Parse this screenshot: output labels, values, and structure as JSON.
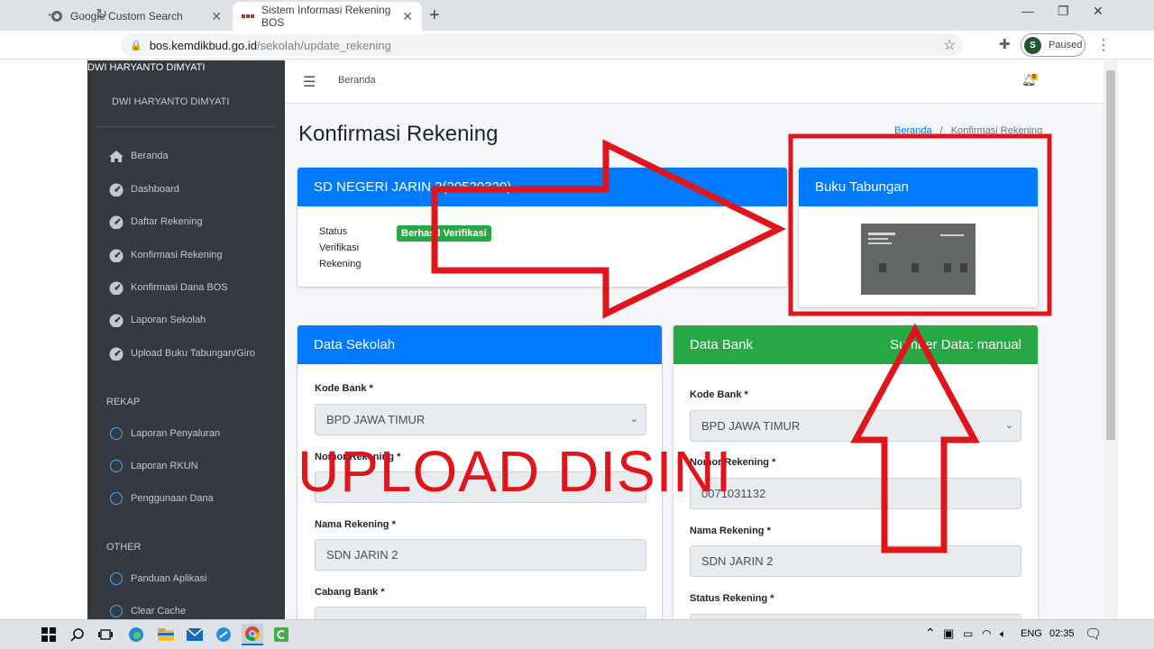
{
  "browser": {
    "tabs": [
      {
        "label": "Google Custom Search",
        "active": false
      },
      {
        "label": "Sistem Informasi Rekening BOS",
        "active": true
      }
    ],
    "url_host": "bos.kemdikbud.go.id",
    "url_path": "/sekolah/update_rekening",
    "profile_initial": "S",
    "profile_status": "Paused"
  },
  "sidebar": {
    "brand": "DWI HARYANTO DIMYATI",
    "user": "DWI HARYANTO DIMYATI",
    "items": [
      {
        "label": "Beranda",
        "icon": "home-icon"
      },
      {
        "label": "Dashboard",
        "icon": "dashboard-gauge-icon"
      },
      {
        "label": "Daftar Rekening",
        "icon": "dashboard-gauge-icon"
      },
      {
        "label": "Konfirmasi Rekening",
        "icon": "dashboard-gauge-icon"
      },
      {
        "label": "Konfirmasi Dana BOS",
        "icon": "dashboard-gauge-icon"
      },
      {
        "label": "Laporan Sekolah",
        "icon": "dashboard-gauge-icon"
      },
      {
        "label": "Upload Buku Tabungan/Giro",
        "icon": "dashboard-gauge-icon"
      }
    ],
    "rekap_header": "REKAP",
    "rekap_items": [
      "Laporan Penyaluran",
      "Laporan RKUN",
      "Penggunaan Dana"
    ],
    "other_header": "OTHER",
    "other_items": [
      "Panduan Aplikasi",
      "Clear Cache"
    ]
  },
  "topnav": {
    "home": "Beranda",
    "notif_count": "0"
  },
  "page": {
    "title": "Konfirmasi Rekening",
    "breadcrumb_home": "Beranda",
    "breadcrumb_sep": "/",
    "breadcrumb_current": "Konfirmasi Rekening"
  },
  "school_card": {
    "header": "SD NEGERI JARIN 2(20520320)",
    "status_label": [
      "Status",
      "Verifikasi",
      "Rekening"
    ],
    "status_value": "Berhasil Verifikasi"
  },
  "book_card": {
    "header": "Buku Tabungan"
  },
  "data_sekolah": {
    "header": "Data Sekolah",
    "kode_bank_label": "Kode Bank *",
    "kode_bank_value": "BPD JAWA TIMUR",
    "nomor_rekening_label": "Nomor Rekening *",
    "nomor_rekening_value": "",
    "nama_rekening_label": "Nama Rekening *",
    "nama_rekening_value": "SDN JARIN 2",
    "cabang_bank_label": "Cabang Bank *"
  },
  "data_bank": {
    "header": "Data Bank",
    "source": "Sumber Data: manual",
    "kode_bank_label": "Kode Bank *",
    "kode_bank_value": "BPD JAWA TIMUR",
    "nomor_rekening_label": "Nomor Rekening *",
    "nomor_rekening_value": "0071031132",
    "nama_rekening_label": "Nama Rekening *",
    "nama_rekening_value": "SDN JARIN 2",
    "status_rekening_label": "Status Rekening *"
  },
  "annotation": {
    "text": "UPLOAD DISINI",
    "color": "#e0141b"
  },
  "taskbar": {
    "lang": "ENG",
    "time": "02:35"
  }
}
